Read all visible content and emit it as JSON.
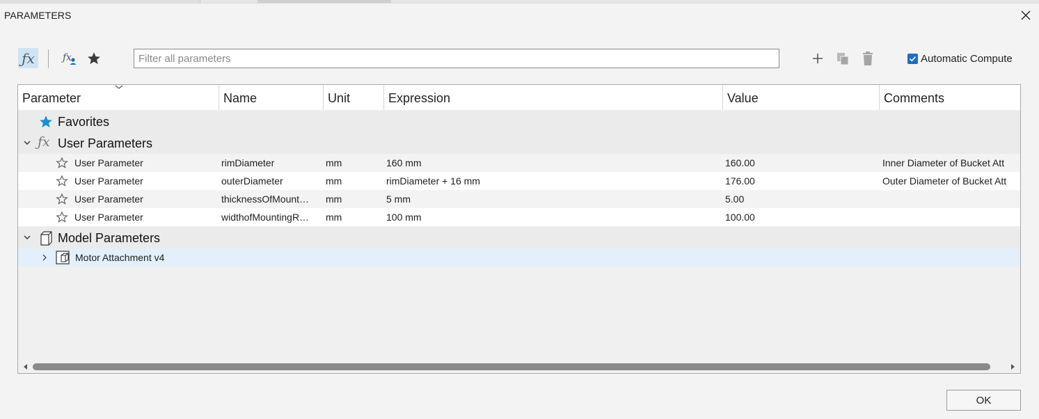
{
  "window": {
    "title": "PARAMETERS",
    "close_icon": "close-icon"
  },
  "toolbar": {
    "fx_toggle_icon": "function-fx-icon",
    "user_fx_icon": "user-function-icon",
    "favorites_icon": "favorites-star-icon",
    "filter_placeholder": "Filter all parameters",
    "filter_value": "",
    "add_icon": "plus-icon",
    "copy_icon": "copy-icon",
    "delete_icon": "trash-icon",
    "auto_compute": {
      "label": "Automatic Compute",
      "checked": true
    }
  },
  "table": {
    "columns": [
      "Parameter",
      "Name",
      "Unit",
      "Expression",
      "Value",
      "Comments"
    ],
    "groups": {
      "favorites": {
        "label": "Favorites"
      },
      "user_params": {
        "label": "User Parameters"
      },
      "model_params": {
        "label": "Model Parameters"
      }
    },
    "user_rows": [
      {
        "parameter": "User Parameter",
        "name": "rimDiameter",
        "unit": "mm",
        "expression": "160 mm",
        "value": "160.00",
        "comment": "Inner Diameter of Bucket Att"
      },
      {
        "parameter": "User Parameter",
        "name": "outerDiameter",
        "unit": "mm",
        "expression": "rimDiameter + 16 mm",
        "value": "176.00",
        "comment": "Outer Diameter of Bucket Att"
      },
      {
        "parameter": "User Parameter",
        "name": "thicknessOfMount…",
        "unit": "mm",
        "expression": "5 mm",
        "value": "5.00",
        "comment": ""
      },
      {
        "parameter": "User Parameter",
        "name": "widthofMountingR…",
        "unit": "mm",
        "expression": "100 mm",
        "value": "100.00",
        "comment": ""
      }
    ],
    "model_rows": [
      {
        "label": "Motor Attachment v4"
      }
    ]
  },
  "footer": {
    "ok_label": "OK"
  },
  "colors": {
    "accent": "#1f6ec4",
    "favorite_star": "#1a8fd1",
    "selected_row": "#e3f0fb",
    "fx_active_bg": "#cfe3f3"
  }
}
